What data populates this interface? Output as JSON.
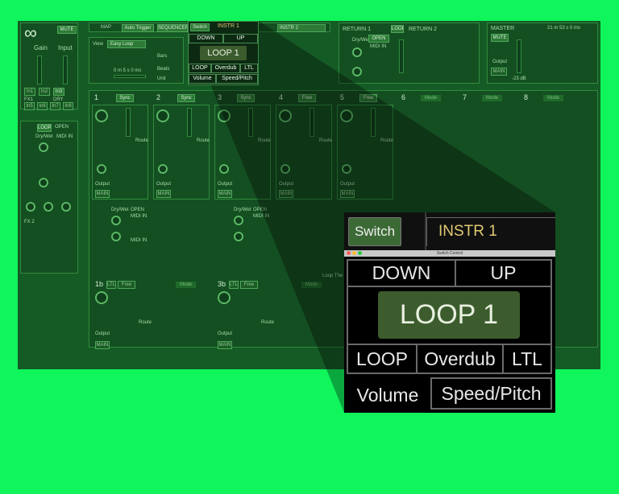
{
  "colors": {
    "background": "#10f55c",
    "app_bg": "#155b25",
    "loop_box": "#3c5c2e",
    "instr_text": "#e0c873"
  },
  "app": {
    "mute_label": "MUTE",
    "gain_label": "Gain",
    "input_label": "Input",
    "in_buttons": [
      "In1",
      "In2",
      "In3"
    ],
    "fx_buttons": [
      "In5",
      "In6",
      "In7",
      "In8"
    ],
    "fx1_label": "FX1",
    "dry_label": "DRY",
    "fx2_label": "FX 2",
    "toolbar": {
      "map": "MAP",
      "auto_trigger": "Auto Trigger",
      "sequencer": "SEQUENCER",
      "switch": "Switch",
      "instr1": "INSTR 1",
      "instr2": "INSTR 2"
    },
    "easy_loop": "Easy Loop",
    "bars": "Bars",
    "beats": "Beats",
    "unit": "Unit",
    "time_value": "0 m 5 s 0 ms",
    "return1": "RETURN 1",
    "return2": "RETURN 2",
    "loop_tag": "LOOP",
    "open_label": "OPEN",
    "dry_wet": "Dry/Wet",
    "midi_in": "MIDI IN",
    "master": "MASTER",
    "master_mute": "MUTE",
    "output": "Output",
    "main": "MAIN",
    "clock": "21 m 53 s 0 ms",
    "db_value": "-23 dB",
    "tracks": [
      {
        "num": "1",
        "sync": "Sync"
      },
      {
        "num": "2",
        "sync": "Sync"
      },
      {
        "num": "3",
        "sync": "Sync"
      },
      {
        "num": "4",
        "sync": "Free"
      },
      {
        "num": "5",
        "sync": "Free"
      },
      {
        "num": "6",
        "sync": ""
      },
      {
        "num": "7",
        "sync": ""
      },
      {
        "num": "8",
        "sync": ""
      }
    ],
    "mode_label": "Mode",
    "route_label": "Route",
    "loop_the": "Loop The",
    "track_1b": "1b",
    "track_3b": "3b",
    "ltl": "LTL",
    "free": "Free"
  },
  "mini_switch": {
    "switch_label": "Switch",
    "instr_label": "INSTR 1",
    "down": "DOWN",
    "up": "UP",
    "loop_name": "LOOP 1",
    "loop": "LOOP",
    "overdub": "Overdub",
    "ltl": "LTL",
    "volume": "Volume",
    "speed_pitch": "Speed/Pitch"
  },
  "zoom": {
    "switch_label": "Switch",
    "instr_label": "INSTR 1",
    "window_title": "Switch Control",
    "down": "DOWN",
    "up": "UP",
    "loop_name": "LOOP 1",
    "loop": "LOOP",
    "overdub": "Overdub",
    "ltl": "LTL",
    "volume": "Volume",
    "speed_pitch": "Speed/Pitch"
  }
}
